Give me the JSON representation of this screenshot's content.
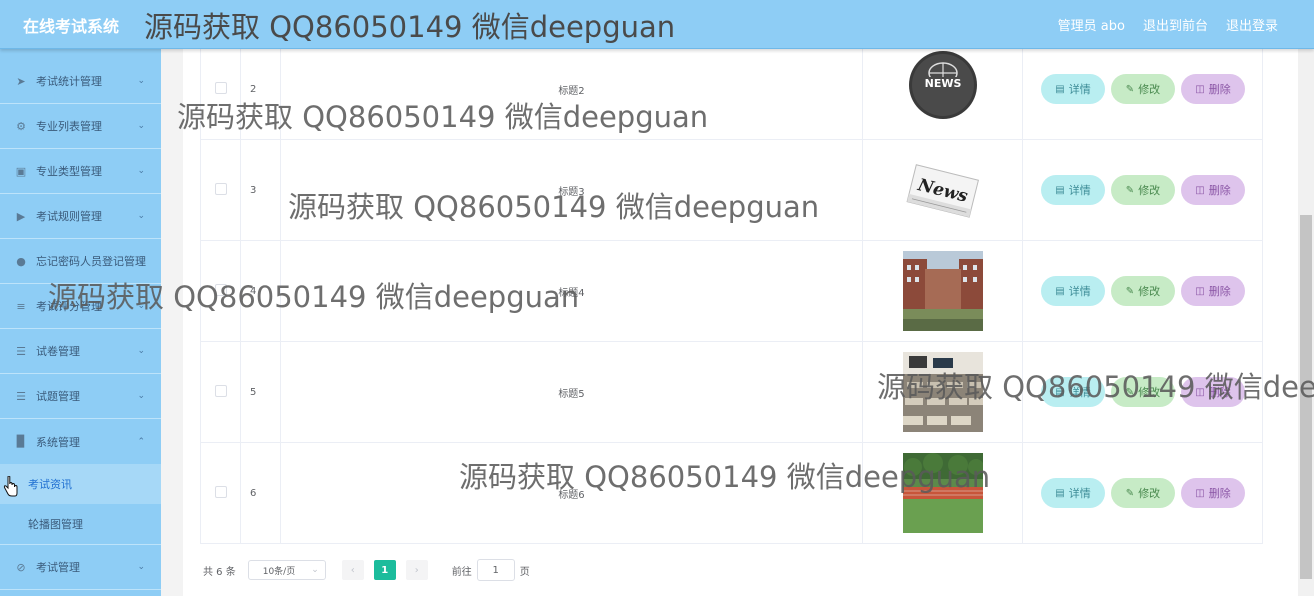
{
  "header": {
    "logo": "在线考试系统",
    "links": [
      "管理员 abo",
      "退出到前台",
      "退出登录"
    ]
  },
  "sidebar": {
    "items": [
      {
        "label": "考试统计管理",
        "icon": "paper-plane-icon"
      },
      {
        "label": "专业列表管理",
        "icon": "aperture-icon"
      },
      {
        "label": "专业类型管理",
        "icon": "clipboard-icon"
      },
      {
        "label": "考试规则管理",
        "icon": "thumb-icon"
      },
      {
        "label": "忘记密码人员登记管理",
        "icon": "user-icon"
      },
      {
        "label": "考试评分管理",
        "icon": "sliders-icon"
      },
      {
        "label": "试卷管理",
        "icon": "list-icon"
      },
      {
        "label": "试题管理",
        "icon": "list-icon"
      },
      {
        "label": "系统管理",
        "icon": "chart-icon",
        "expanded": true
      }
    ],
    "sub_items": [
      "考试资讯",
      "轮播图管理"
    ],
    "last_item": {
      "label": "考试管理",
      "icon": "bell-off-icon"
    }
  },
  "table": {
    "rows": [
      {
        "index": "2",
        "title": "标题2",
        "image": "news-globe-icon"
      },
      {
        "index": "3",
        "title": "标题3",
        "image": "newspaper-icon"
      },
      {
        "index": "4",
        "title": "标题4",
        "image": "campus-building-photo"
      },
      {
        "index": "5",
        "title": "标题5",
        "image": "classroom-photo"
      },
      {
        "index": "6",
        "title": "标题6",
        "image": "sports-track-photo"
      }
    ],
    "actions": {
      "detail": "详情",
      "edit": "修改",
      "delete": "删除"
    }
  },
  "pagination": {
    "total": "共 6 条",
    "page_size": "10条/页",
    "current_page": "1",
    "goto_label": "前往",
    "goto_value": "1",
    "page_unit": "页"
  },
  "watermark": {
    "text": "源码获取 QQ86050149 微信deepguan"
  },
  "colors": {
    "header_bg": "#8ecdf5",
    "sidebar_bg": "#8ecdf5",
    "active_page": "#1cbc9c"
  }
}
